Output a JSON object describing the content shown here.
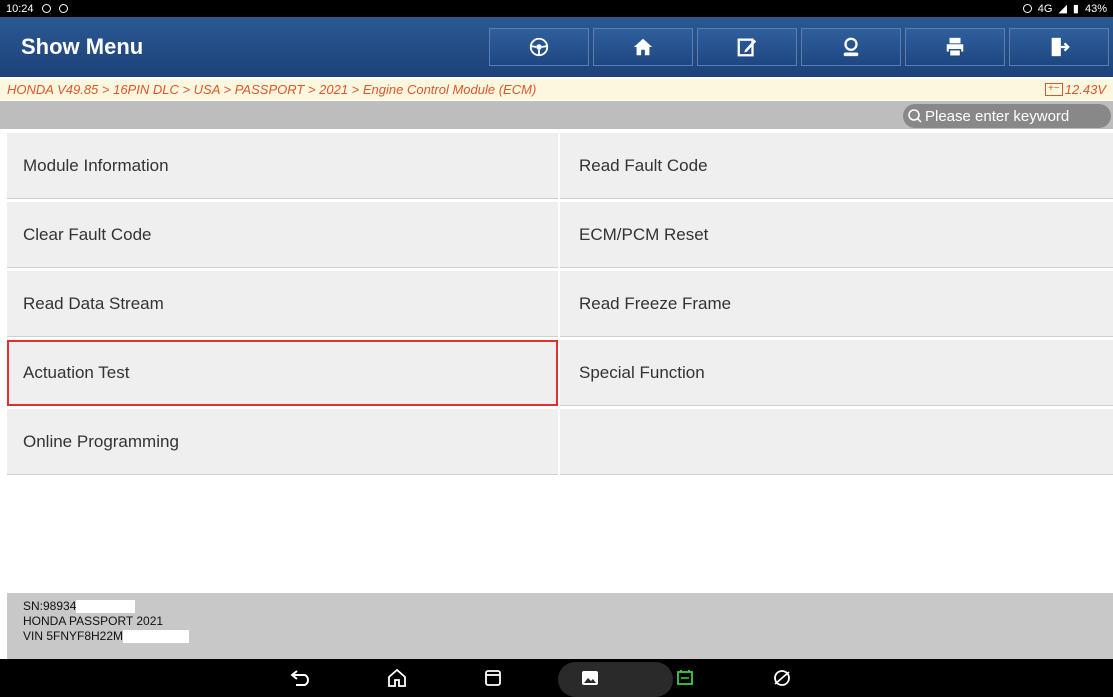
{
  "status_bar": {
    "time": "10:24",
    "network": "4G",
    "battery": "43%"
  },
  "header": {
    "title": "Show Menu",
    "tools": [
      "steering-wheel-icon",
      "home-icon",
      "edit-report-icon",
      "user-icon",
      "print-icon",
      "exit-icon"
    ]
  },
  "breadcrumb": {
    "path": "HONDA V49.85 > 16PIN DLC > USA > PASSPORT > 2021 > Engine Control Module (ECM)",
    "voltage": "12.43V"
  },
  "search": {
    "placeholder": "Please enter keyword"
  },
  "menu": {
    "items": [
      {
        "label": "Module Information"
      },
      {
        "label": "Read Fault Code"
      },
      {
        "label": "Clear Fault Code"
      },
      {
        "label": "ECM/PCM Reset"
      },
      {
        "label": "Read Data Stream"
      },
      {
        "label": "Read Freeze Frame"
      },
      {
        "label": "Actuation Test"
      },
      {
        "label": "Special Function"
      },
      {
        "label": "Online Programming"
      },
      {
        "label": ""
      }
    ],
    "selected_label": "Actuation Test"
  },
  "info": {
    "sn": "SN:98934",
    "vehicle": "HONDA PASSPORT 2021",
    "vin": "VIN 5FNYF8H22M"
  },
  "colors": {
    "header": "#1c4178",
    "breadcrumb_text": "#e0552a",
    "selection": "#e0302f"
  }
}
